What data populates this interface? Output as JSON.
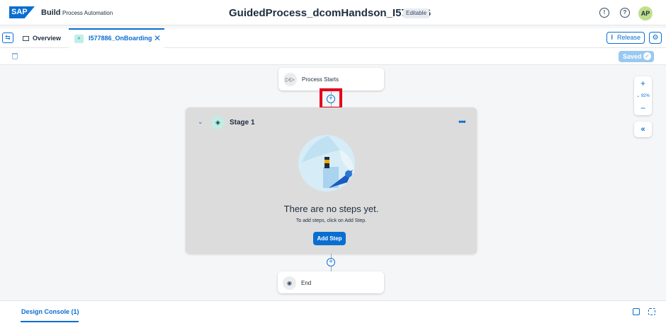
{
  "header": {
    "logo_text": "SAP",
    "brand": "Build",
    "product": "Process Automation",
    "project_title": "GuidedProcess_dcomHandson_I577886",
    "status_badge": "Editable",
    "icons": [
      "notifications-icon",
      "help-icon"
    ],
    "avatar_initials": "AP"
  },
  "tabs": {
    "overview_label": "Overview",
    "active_label": "I577886_OnBoarding",
    "release_label": "Release"
  },
  "toolbar": {
    "saved_label": "Saved"
  },
  "canvas": {
    "start_label": "Process Starts",
    "end_label": "End",
    "stage": {
      "title": "Stage 1",
      "empty_title": "There are no steps yet.",
      "empty_hint": "To add steps, click on Add Step.",
      "add_step_label": "Add Step"
    },
    "zoom_level": "92%"
  },
  "console": {
    "tab_label": "Design Console (1)"
  },
  "colors": {
    "accent": "#0a6ed1",
    "highlight": "#e3001b",
    "stage_bg": "#dcdcdc"
  }
}
